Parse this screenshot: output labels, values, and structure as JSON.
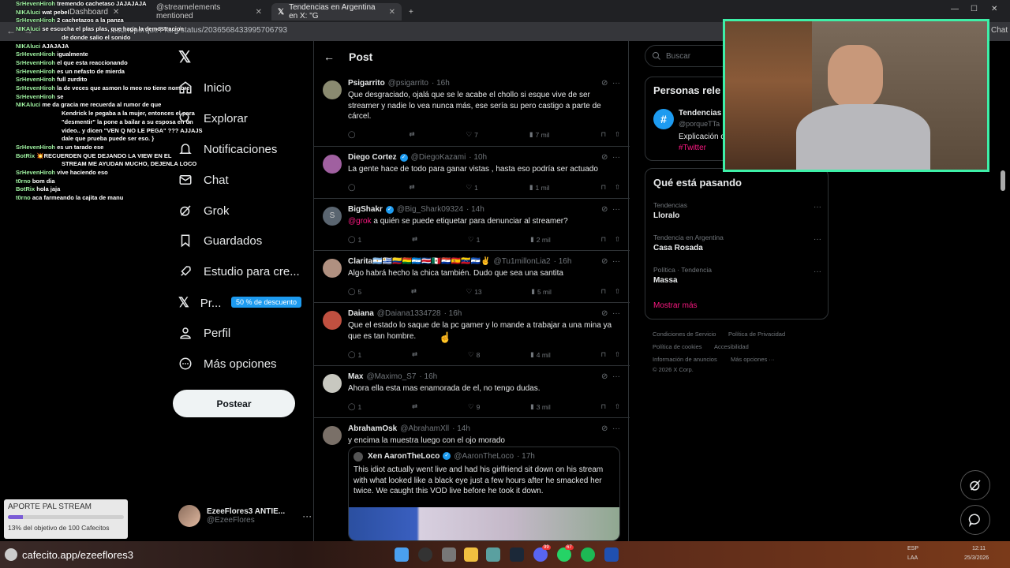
{
  "browser": {
    "tabs": [
      {
        "label": "Dashboard",
        "active": false
      },
      {
        "label": "@streamelements mentioned",
        "active": false
      },
      {
        "label": "Tendencias en Argentina en X: \"G",
        "active": true
      }
    ],
    "url": "x.com/porqueTTarg/status/2036568433995706793"
  },
  "nav": {
    "items": [
      "Inicio",
      "Explorar",
      "Notificaciones",
      "Chat",
      "Grok",
      "Guardados",
      "Estudio para cre...",
      "Pr...",
      "Perfil",
      "Más opciones"
    ],
    "promo_badge": "50 % de descuento",
    "post_button": "Postear",
    "profile_name": "EzeeFlores3 ANTIE...",
    "profile_handle": "@EzeeFlores"
  },
  "post_header": {
    "title": "Post"
  },
  "replies": [
    {
      "name": "Psigarrito",
      "handle": "@psigarrito",
      "time": "· 16h",
      "verified": false,
      "body": "Que desgraciado, ojalá que se le acabe el chollo si esque vive de ser streamer y nadie lo vea nunca más, ese sería su pero castigo a parte de cárcel.",
      "replies": "",
      "reposts": "",
      "likes": "7",
      "views": "7 mil"
    },
    {
      "name": "Diego Cortez",
      "handle": "@DiegoKazami",
      "time": "· 10h",
      "verified": true,
      "body": "La gente hace de todo para ganar vistas ,  hasta eso podría ser actuado",
      "replies": "",
      "reposts": "",
      "likes": "1",
      "views": "1 mil"
    },
    {
      "name": "BigShakr",
      "handle": "@Big_Shark09324",
      "time": "· 14h",
      "verified": true,
      "mention": "@grok",
      "body": " a quién se puede etiquetar para denunciar al streamer?",
      "replies": "1",
      "reposts": "",
      "likes": "1",
      "views": "2 mil"
    },
    {
      "name": "Clarita🇦🇷🇺🇾🇨🇴🇧🇴🇭🇳🇨🇷🇲🇽🇵🇾🇪🇸🇻🇪🇸🇻✌",
      "handle": "@Tu1millonLia2",
      "time": "· 16h",
      "verified": false,
      "body": "Algo habrá hecho la chica también. Dudo que sea una santita",
      "replies": "5",
      "reposts": "",
      "likes": "13",
      "views": "5 mil"
    },
    {
      "name": "Daiana",
      "handle": "@Daiana1334728",
      "time": "· 16h",
      "verified": false,
      "body": "Que el estado lo saque de la pc gamer y lo mande a trabajar a una mina ya que es tan hombre.",
      "replies": "1",
      "reposts": "",
      "likes": "8",
      "views": "4 mil"
    },
    {
      "name": "Max",
      "handle": "@Maximo_S7",
      "time": "· 16h",
      "verified": false,
      "body": "Ahora ella esta mas enamorada de el, no tengo dudas.",
      "replies": "1",
      "reposts": "",
      "likes": "9",
      "views": "3 mil"
    },
    {
      "name": "AbrahamOsk",
      "handle": "@AbrahamXll",
      "time": "· 14h",
      "verified": false,
      "body": "y encima la muestra luego con el ojo morado"
    }
  ],
  "quote": {
    "name": "Xen AaronTheLoco",
    "handle": "@AaronTheLoco",
    "time": "· 17h",
    "body": "This idiot actually went live and had his girlfriend sit down on his stream with what looked like a black eye just a few hours after he smacked her twice. We caught this VOD live before he took it down."
  },
  "sidebar": {
    "search_placeholder": "Buscar",
    "people_title": "Personas rele",
    "people_name": "Tendencias",
    "people_handle": "@porqueTTa",
    "people_desc": "Explicación d",
    "people_tag": "#Twitter",
    "trends_title": "Qué está pasando",
    "trends": [
      {
        "category": "Tendencias",
        "name": "Lloralo"
      },
      {
        "category": "Tendencia en Argentina",
        "name": "Casa Rosada"
      },
      {
        "category": "Política · Tendencia",
        "name": "Massa"
      }
    ],
    "show_more": "Mostrar más",
    "footer": [
      "Condiciones de Servicio",
      "Política de Privacidad",
      "Política de cookies",
      "Accesibilidad",
      "Información de anuncios",
      "Más opciones ···",
      "© 2026 X Corp."
    ]
  },
  "chat_overlay": [
    {
      "user": "SrHevenHiroh",
      "msg": "tremendo cachetaso JAJAJAJA"
    },
    {
      "user": "NIKAluci",
      "msg": "wat pebel"
    },
    {
      "user": "SrHevenHiroh",
      "msg": "2 cachetazos a la panza"
    },
    {
      "user": "NIKAluci",
      "msg": "se escucha el plas plas, que haga la demostracion"
    },
    {
      "user": "",
      "msg": "de donde salio el sonido"
    },
    {
      "user": "NIKAluci",
      "msg": "AJAJAJA"
    },
    {
      "user": "SrHevenHiroh",
      "msg": "igualmente"
    },
    {
      "user": "SrHevenHiroh",
      "msg": "el que esta reaccionando"
    },
    {
      "user": "SrHevenHiroh",
      "msg": "es un nefasto de mierda"
    },
    {
      "user": "SrHevenHiroh",
      "msg": "full zurdito"
    },
    {
      "user": "SrHevenHiroh",
      "msg": "la de veces que asmon lo meo no tiene nombre"
    },
    {
      "user": "SrHevenHiroh",
      "msg": "se"
    },
    {
      "user": "NIKAluci",
      "msg": "me da gracia me recuerda al rumor de que"
    },
    {
      "user": "",
      "msg": "Kendrick le pegaba a la mujer, entonces el para"
    },
    {
      "user": "",
      "msg": "\"desmentir\" la pone a bailar a su esposa en un"
    },
    {
      "user": "",
      "msg": "video.. y dicen \"VEN Q NO LE PEGA\" ??? AJJAJS"
    },
    {
      "user": "",
      "msg": "dale que prueba puede ser eso. }"
    },
    {
      "user": "SrHevenHiroh",
      "msg": "es un tarado ese"
    },
    {
      "user": "BotRix",
      "msg": "💥RECUERDEN QUE DEJANDO LA VIEW EN EL"
    },
    {
      "user": "",
      "msg": "STREAM ME AYUDAN MUCHO, DEJENLA LOCO"
    },
    {
      "user": "SrHevenHiroh",
      "msg": "vive haciendo eso"
    },
    {
      "user": "t0rno",
      "msg": "bom dia"
    },
    {
      "user": "BotRix",
      "msg": "hola jaja"
    },
    {
      "user": "t0rno",
      "msg": "aca farmeando la cajita de manu"
    }
  ],
  "donation": {
    "title": "APORTE PAL STREAM",
    "progress_percent": 13,
    "caption": "13% del objetivo de 100 Cafecitos"
  },
  "taskbar": {
    "cafecito_url": "cafecito.app/ezeeflores3",
    "lang1": "ESP",
    "lang2": "LAA",
    "time": "12:11",
    "date": "25/3/2026",
    "badge1": "99",
    "badge2": "67"
  },
  "colors": {
    "accent": "#1d9bf0",
    "pink": "#f91880",
    "cam_border": "#3ef0a8"
  }
}
